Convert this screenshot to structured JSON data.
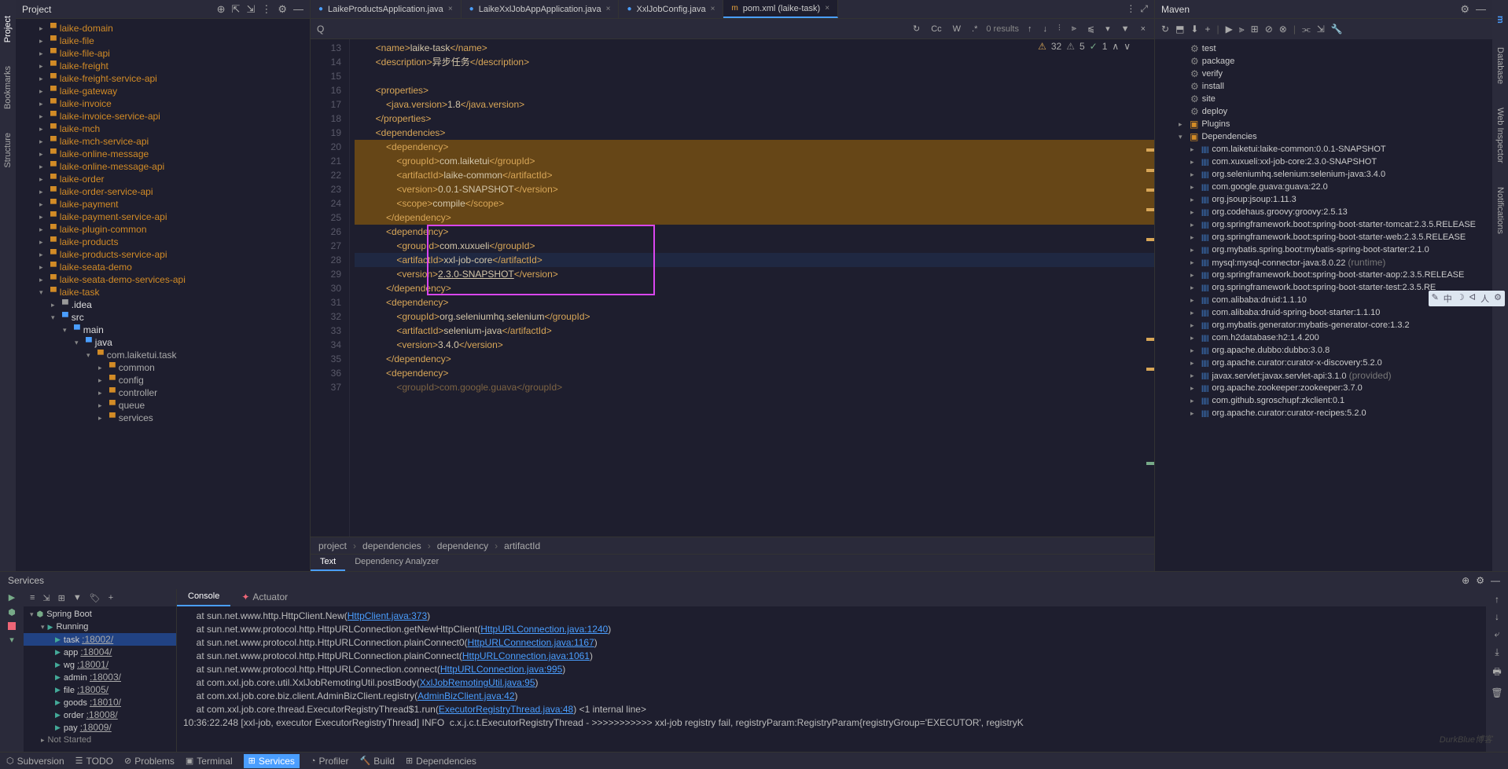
{
  "sidebarLeft": [
    "Project",
    "Bookmarks",
    "Structure"
  ],
  "sidebarRight": [
    "Maven",
    "Database",
    "Web Inspector",
    "Notifications"
  ],
  "projectPanel": {
    "title": "Project",
    "tree": [
      {
        "label": "laike-domain",
        "depth": 0,
        "bold": true,
        "arrow": "▸"
      },
      {
        "label": "laike-file",
        "depth": 0,
        "bold": true,
        "arrow": "▸"
      },
      {
        "label": "laike-file-api",
        "depth": 0,
        "bold": true,
        "arrow": "▸"
      },
      {
        "label": "laike-freight",
        "depth": 0,
        "bold": true,
        "arrow": "▸"
      },
      {
        "label": "laike-freight-service-api",
        "depth": 0,
        "bold": true,
        "arrow": "▸"
      },
      {
        "label": "laike-gateway",
        "depth": 0,
        "bold": true,
        "arrow": "▸"
      },
      {
        "label": "laike-invoice",
        "depth": 0,
        "bold": true,
        "arrow": "▸"
      },
      {
        "label": "laike-invoice-service-api",
        "depth": 0,
        "bold": true,
        "arrow": "▸"
      },
      {
        "label": "laike-mch",
        "depth": 0,
        "bold": true,
        "arrow": "▸"
      },
      {
        "label": "laike-mch-service-api",
        "depth": 0,
        "bold": true,
        "arrow": "▸"
      },
      {
        "label": "laike-online-message",
        "depth": 0,
        "bold": true,
        "arrow": "▸"
      },
      {
        "label": "laike-online-message-api",
        "depth": 0,
        "bold": true,
        "arrow": "▸"
      },
      {
        "label": "laike-order",
        "depth": 0,
        "bold": true,
        "arrow": "▸"
      },
      {
        "label": "laike-order-service-api",
        "depth": 0,
        "bold": true,
        "arrow": "▸"
      },
      {
        "label": "laike-payment",
        "depth": 0,
        "bold": true,
        "arrow": "▸"
      },
      {
        "label": "laike-payment-service-api",
        "depth": 0,
        "bold": true,
        "arrow": "▸"
      },
      {
        "label": "laike-plugin-common",
        "depth": 0,
        "bold": true,
        "arrow": "▸"
      },
      {
        "label": "laike-products",
        "depth": 0,
        "bold": true,
        "arrow": "▸"
      },
      {
        "label": "laike-products-service-api",
        "depth": 0,
        "bold": true,
        "arrow": "▸"
      },
      {
        "label": "laike-seata-demo",
        "depth": 0,
        "bold": true,
        "arrow": "▸"
      },
      {
        "label": "laike-seata-demo-services-api",
        "depth": 0,
        "bold": true,
        "arrow": "▸"
      },
      {
        "label": "laike-task",
        "depth": 0,
        "bold": true,
        "arrow": "▾"
      },
      {
        "label": ".idea",
        "depth": 1,
        "arrow": "▸",
        "color": "gray"
      },
      {
        "label": "src",
        "depth": 1,
        "arrow": "▾",
        "color": "blue"
      },
      {
        "label": "main",
        "depth": 2,
        "arrow": "▾",
        "color": "blue"
      },
      {
        "label": "java",
        "depth": 3,
        "arrow": "▾",
        "color": "blue"
      },
      {
        "label": "com.laiketui.task",
        "depth": 4,
        "arrow": "▾",
        "pkg": true
      },
      {
        "label": "common",
        "depth": 5,
        "arrow": "▸",
        "pkg": true
      },
      {
        "label": "config",
        "depth": 5,
        "arrow": "▸",
        "pkg": true
      },
      {
        "label": "controller",
        "depth": 5,
        "arrow": "▸",
        "pkg": true
      },
      {
        "label": "queue",
        "depth": 5,
        "arrow": "▸",
        "pkg": true
      },
      {
        "label": "services",
        "depth": 5,
        "arrow": "▸",
        "pkg": true
      }
    ]
  },
  "tabs": [
    {
      "label": "LaikeProductsApplication.java",
      "icon": "●",
      "iconColor": "blue"
    },
    {
      "label": "LaikeXxlJobAppApplication.java",
      "icon": "●",
      "iconColor": "blue"
    },
    {
      "label": "XxlJobConfig.java",
      "icon": "●",
      "iconColor": "blue"
    },
    {
      "label": "pom.xml (laike-task)",
      "icon": "m",
      "iconColor": "orange",
      "active": true
    }
  ],
  "searchBar": {
    "results": "0 results"
  },
  "codeWarnings": {
    "warn": "32",
    "weak": "5",
    "ok": "1"
  },
  "code": {
    "startLine": 13,
    "lines": [
      {
        "n": 13,
        "indent": 8,
        "html": "<span class='tag'>&lt;name&gt;</span><span class='txt'>laike-task</span><span class='tag'>&lt;/name&gt;</span>"
      },
      {
        "n": 14,
        "indent": 8,
        "html": "<span class='tag'>&lt;description&gt;</span><span class='txt'>异步任务</span><span class='tag'>&lt;/description&gt;</span>"
      },
      {
        "n": 15,
        "indent": 0,
        "html": ""
      },
      {
        "n": 16,
        "indent": 8,
        "html": "<span class='tag'>&lt;properties&gt;</span>"
      },
      {
        "n": 17,
        "indent": 12,
        "html": "<span class='tag'>&lt;java.version&gt;</span><span class='txt'>1.8</span><span class='tag'>&lt;/java.version&gt;</span>"
      },
      {
        "n": 18,
        "indent": 8,
        "html": "<span class='tag'>&lt;/properties&gt;</span>"
      },
      {
        "n": 19,
        "indent": 8,
        "html": "<span class='tag'>&lt;dependencies&gt;</span>"
      },
      {
        "n": 20,
        "indent": 12,
        "html": "<span class='hl-orange'><span class='tag'>&lt;dependency&gt;</span></span>",
        "hl": false,
        "block": "o"
      },
      {
        "n": 21,
        "indent": 16,
        "html": "<span class='hl-orange'><span class='tag'>&lt;groupId&gt;</span><span class='txt'>com.laiketui</span><span class='tag'>&lt;/groupId&gt;</span></span>",
        "block": "o"
      },
      {
        "n": 22,
        "indent": 16,
        "html": "<span class='hl-orange'><span class='tag'>&lt;artifactId&gt;</span><span class='txt'>laike-common</span><span class='tag'>&lt;/artifactId&gt;</span></span>",
        "block": "o"
      },
      {
        "n": 23,
        "indent": 16,
        "html": "<span class='hl-orange'><span class='tag'>&lt;version&gt;</span><span class='txt'>0.0.1-SNAPSHOT</span><span class='tag'>&lt;/version&gt;</span></span>",
        "block": "o"
      },
      {
        "n": 24,
        "indent": 16,
        "html": "<span class='hl-orange'><span class='tag'>&lt;scope&gt;</span><span class='txt'>compile</span><span class='tag'>&lt;/scope&gt;</span></span>",
        "block": "o"
      },
      {
        "n": 25,
        "indent": 12,
        "html": "<span class='hl-orange'><span class='tag'>&lt;/dependency&gt;</span></span>",
        "block": "o"
      },
      {
        "n": 26,
        "indent": 12,
        "html": "<span class='tag'>&lt;dependency&gt;</span>",
        "box": true
      },
      {
        "n": 27,
        "indent": 16,
        "html": "<span class='tag'>&lt;groupId&gt;</span><span class='txt'>com.xuxueli</span><span class='tag'>&lt;/groupId&gt;</span>",
        "box": true
      },
      {
        "n": 28,
        "indent": 16,
        "html": "<span class='tag'>&lt;artifactId&gt;</span><span class='txt'>xxl-job-core</span><span class='tag'>&lt;/artifactId&gt;</span>",
        "hl": true,
        "bulb": true,
        "box": true
      },
      {
        "n": 29,
        "indent": 16,
        "html": "<span class='tag'>&lt;version&gt;</span><span class='txt' style='text-decoration:underline'>2.3.0-SNAPSHOT</span><span class='tag'>&lt;/version&gt;</span>",
        "box": true
      },
      {
        "n": 30,
        "indent": 12,
        "html": "<span class='tag'>&lt;/dependency&gt;</span>",
        "box": true
      },
      {
        "n": 31,
        "indent": 12,
        "html": "<span class='tag'>&lt;dependency&gt;</span>"
      },
      {
        "n": 32,
        "indent": 16,
        "html": "<span class='tag'>&lt;groupId&gt;</span><span class='txt'>org.seleniumhq.selenium</span><span class='tag'>&lt;/groupId&gt;</span>"
      },
      {
        "n": 33,
        "indent": 16,
        "html": "<span class='tag'>&lt;artifactId&gt;</span><span class='txt'>selenium-java</span><span class='tag'>&lt;/artifactId&gt;</span>"
      },
      {
        "n": 34,
        "indent": 16,
        "html": "<span class='tag'>&lt;version&gt;</span><span class='txt'>3.4.0</span><span class='tag'>&lt;/version&gt;</span>"
      },
      {
        "n": 35,
        "indent": 12,
        "html": "<span class='tag'>&lt;/dependency&gt;</span>"
      },
      {
        "n": 36,
        "indent": 12,
        "html": "<span class='tag'>&lt;dependency&gt;</span>"
      },
      {
        "n": 37,
        "indent": 16,
        "html": "<span class='tag' style='opacity:.5'>&lt;groupId&gt;com.google.guava&lt;/groupId&gt;</span>"
      }
    ]
  },
  "breadcrumb": [
    "project",
    "dependencies",
    "dependency",
    "artifactId"
  ],
  "subTabs": [
    "Text",
    "Dependency Analyzer"
  ],
  "maven": {
    "title": "Maven",
    "lifecycle": [
      "test",
      "package",
      "verify",
      "install",
      "site",
      "deploy"
    ],
    "nodes": [
      "Plugins",
      "Dependencies"
    ],
    "deps": [
      "com.laiketui:laike-common:0.0.1-SNAPSHOT",
      "com.xuxueli:xxl-job-core:2.3.0-SNAPSHOT",
      "org.seleniumhq.selenium:selenium-java:3.4.0",
      "com.google.guava:guava:22.0",
      "org.jsoup:jsoup:1.11.3",
      "org.codehaus.groovy:groovy:2.5.13",
      "org.springframework.boot:spring-boot-starter-tomcat:2.3.5.RELEASE",
      "org.springframework.boot:spring-boot-starter-web:2.3.5.RELEASE",
      "org.mybatis.spring.boot:mybatis-spring-boot-starter:2.1.0",
      "mysql:mysql-connector-java:8.0.22 (runtime)",
      "org.springframework.boot:spring-boot-starter-aop:2.3.5.RELEASE",
      "org.springframework.boot:spring-boot-starter-test:2.3.5.RE",
      "com.alibaba:druid:1.1.10",
      "com.alibaba:druid-spring-boot-starter:1.1.10",
      "org.mybatis.generator:mybatis-generator-core:1.3.2",
      "com.h2database:h2:1.4.200",
      "org.apache.dubbo:dubbo:3.0.8",
      "org.apache.curator:curator-x-discovery:5.2.0",
      "javax.servlet:javax.servlet-api:3.1.0 (provided)",
      "org.apache.zookeeper:zookeeper:3.7.0",
      "com.github.sgroschupf:zkclient:0.1",
      "org.apache.curator:curator-recipes:5.2.0"
    ]
  },
  "services": {
    "title": "Services",
    "root": "Spring Boot",
    "running": "Running",
    "apps": [
      {
        "name": "task",
        "port": ":18002/",
        "sel": true
      },
      {
        "name": "app",
        "port": ":18004/"
      },
      {
        "name": "wg",
        "port": ":18001/"
      },
      {
        "name": "admin",
        "port": ":18003/"
      },
      {
        "name": "file",
        "port": ":18005/"
      },
      {
        "name": "goods",
        "port": ":18010/"
      },
      {
        "name": "order",
        "port": ":18008/"
      },
      {
        "name": "pay",
        "port": ":18009/"
      }
    ],
    "notStarted": "Not Started",
    "consoleTabs": [
      "Console",
      "Actuator"
    ],
    "console": [
      {
        "pre": "     at sun.net.www.http.HttpClient.New(",
        "link": "HttpClient.java:373",
        "post": ")"
      },
      {
        "pre": "     at sun.net.www.protocol.http.HttpURLConnection.getNewHttpClient(",
        "link": "HttpURLConnection.java:1240",
        "post": ")"
      },
      {
        "pre": "     at sun.net.www.protocol.http.HttpURLConnection.plainConnect0(",
        "link": "HttpURLConnection.java:1167",
        "post": ")"
      },
      {
        "pre": "     at sun.net.www.protocol.http.HttpURLConnection.plainConnect(",
        "link": "HttpURLConnection.java:1061",
        "post": ")"
      },
      {
        "pre": "     at sun.net.www.protocol.http.HttpURLConnection.connect(",
        "link": "HttpURLConnection.java:995",
        "post": ")"
      },
      {
        "pre": "     at com.xxl.job.core.util.XxlJobRemotingUtil.postBody(",
        "link": "XxlJobRemotingUtil.java:95",
        "post": ")"
      },
      {
        "pre": "     at com.xxl.job.core.biz.client.AdminBizClient.registry(",
        "link": "AdminBizClient.java:42",
        "post": ")"
      },
      {
        "pre": "     at com.xxl.job.core.thread.ExecutorRegistryThread$1.run(",
        "link": "ExecutorRegistryThread.java:48",
        "post": ") <1 internal line>"
      },
      {
        "pre": "10:36:22.248 [xxl-job, executor ExecutorRegistryThread] INFO  c.x.j.c.t.ExecutorRegistryThread - >>>>>>>>>>> xxl-job registry fail, registryParam:RegistryParam{registryGroup='EXECUTOR', registryK",
        "link": "",
        "post": ""
      }
    ]
  },
  "statusBar": [
    "Subversion",
    "TODO",
    "Problems",
    "Terminal",
    "Services",
    "Profiler",
    "Build",
    "Dependencies"
  ],
  "watermark": "DurkBlue博客"
}
